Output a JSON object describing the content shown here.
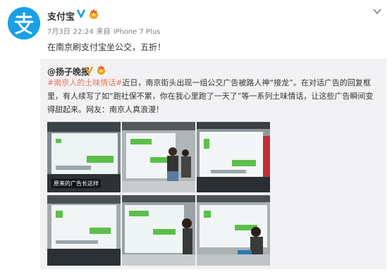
{
  "account": {
    "name": "支付宝",
    "avatar_icon": "alipay-logo-icon",
    "verified_icon": "verified-v-icon",
    "medal_icon": "fan-medal-icon",
    "brand_color": "#1aa0e6"
  },
  "meta": {
    "date": "7月3日",
    "time": "22:24",
    "source_prefix": "来自",
    "device": "iPhone 7 Plus"
  },
  "menu": {
    "icon": "chevron-down-icon"
  },
  "post": {
    "text": "在南京刷支付宝坐公交，五折！"
  },
  "repost": {
    "author": "@扬子晚报",
    "hashtag": "#南京人的土味情话#",
    "text_line1": "近日，南京街头出现一组公交广告被路人神“接龙”。在对话广告的回复框",
    "text_line2": "里，有人续写了如“跑社保不累，你在我心里跑了一天了”等一系列土味情话，让这些广告瞬间变",
    "text_line3": "得甜起来。网友：南京人真浪漫！",
    "hashtag_color": "#eb7350",
    "photos": [
      {
        "caption": "原来的广告长这样"
      },
      {
        "caption": ""
      },
      {
        "caption": ""
      },
      {
        "caption": ""
      },
      {
        "caption": ""
      },
      {
        "caption": ""
      }
    ]
  }
}
